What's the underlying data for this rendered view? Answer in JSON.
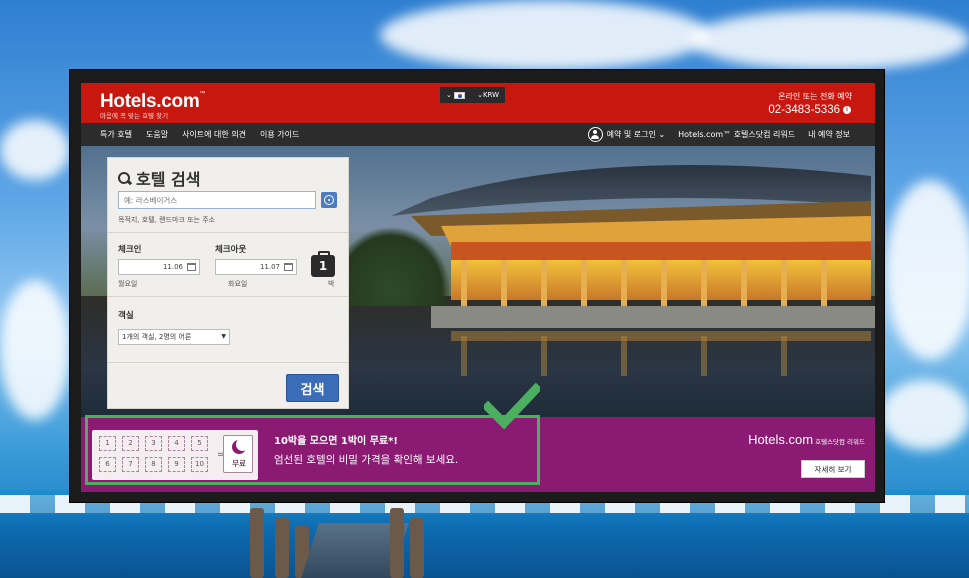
{
  "site": {
    "logo": "Hotels.com",
    "logo_mark": "™",
    "tagline": "마음에 꼭 맞는 호텔 찾기"
  },
  "header": {
    "currency": "KRW",
    "language_icon": "korea-flag-icon",
    "contact_label": "온라인 또는 전화 예약",
    "phone": "02-3483-5336"
  },
  "nav": {
    "left": [
      "특가 호텔",
      "도움말",
      "사이트에 대한 의견",
      "이용 가이드"
    ],
    "account": "예약 및 로그인",
    "rewards": "Hotels.com™ 호텔스닷컴 리워드",
    "bookings": "내 예약 정보"
  },
  "search": {
    "title": "호텔 검색",
    "destination_placeholder": "예: 라스베이거스",
    "destination_hint": "목적지, 호텔, 랜드마크 또는 주소",
    "checkin_label": "체크인",
    "checkin_value": "11.06",
    "checkin_day": "월요일",
    "checkout_label": "체크아웃",
    "checkout_value": "11.07",
    "checkout_day": "화요일",
    "nights_value": "1",
    "nights_label": "박",
    "rooms_label": "객실",
    "rooms_value": "1개의 객실, 2명의 어른",
    "search_button": "검색"
  },
  "banner": {
    "stamps": [
      "1",
      "2",
      "3",
      "4",
      "5",
      "6",
      "7",
      "8",
      "9",
      "10"
    ],
    "equals": "=",
    "free_label": "무료",
    "headline": "10박을 모으면 1박이 무료*!",
    "subline": "엄선된 호텔의 비밀 가격을 확인해 보세요.",
    "logo": "Hotels.com",
    "logo_suffix": "호텔스닷컴 리워드",
    "details_button": "자세히 보기"
  },
  "colors": {
    "brand_red": "#c8170e",
    "banner_purple": "#8b1a73",
    "search_blue": "#3a6cb8",
    "highlight_green": "#4caf60"
  }
}
